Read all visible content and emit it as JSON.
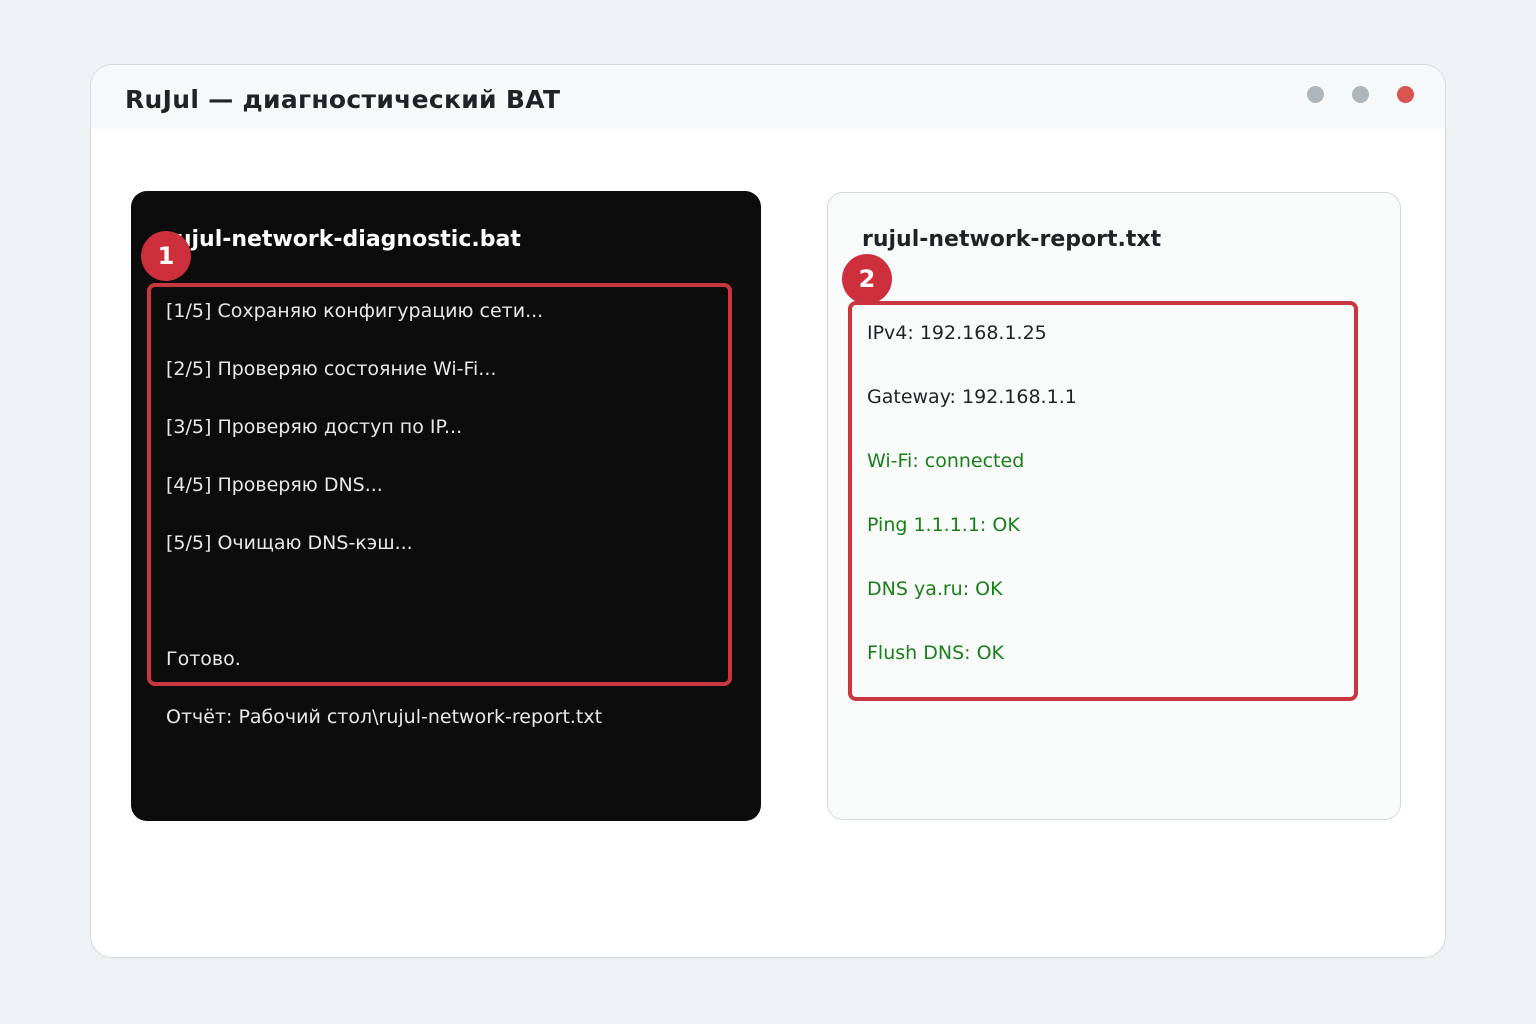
{
  "window": {
    "title": "RuJul — диагностический BAT",
    "controls": [
      {
        "name": "minimize",
        "color": "#adb5bd"
      },
      {
        "name": "maximize",
        "color": "#adb5bd"
      },
      {
        "name": "close",
        "color": "#d9534f"
      }
    ]
  },
  "terminal": {
    "filename": "rujul-network-diagnostic.bat",
    "badge": "1",
    "lines": [
      "[1/5] Сохраняю конфигурацию сети...",
      "[2/5] Проверяю состояние Wi-Fi...",
      "[3/5] Проверяю доступ по IP...",
      "[4/5] Проверяю DNS...",
      "[5/5] Очищаю DNS-кэш...",
      "Готово."
    ],
    "footer": "Отчёт: Рабочий стол\\rujul-network-report.txt"
  },
  "report": {
    "filename": "rujul-network-report.txt",
    "badge": "2",
    "lines": [
      {
        "text": "IPv4: 192.168.1.25",
        "color": "#1f2328"
      },
      {
        "text": "Gateway: 192.168.1.1",
        "color": "#1f2328"
      },
      {
        "text": "Wi-Fi: connected",
        "color": "#1a7f1a"
      },
      {
        "text": "Ping 1.1.1.1: OK",
        "color": "#1a7f1a"
      },
      {
        "text": "DNS ya.ru: OK",
        "color": "#1a7f1a"
      },
      {
        "text": "Flush DNS: OK",
        "color": "#1a7f1a"
      }
    ]
  },
  "colors": {
    "highlight": "#c8363e",
    "badge": "#cd2f3c",
    "ok": "#1a7f1a"
  }
}
